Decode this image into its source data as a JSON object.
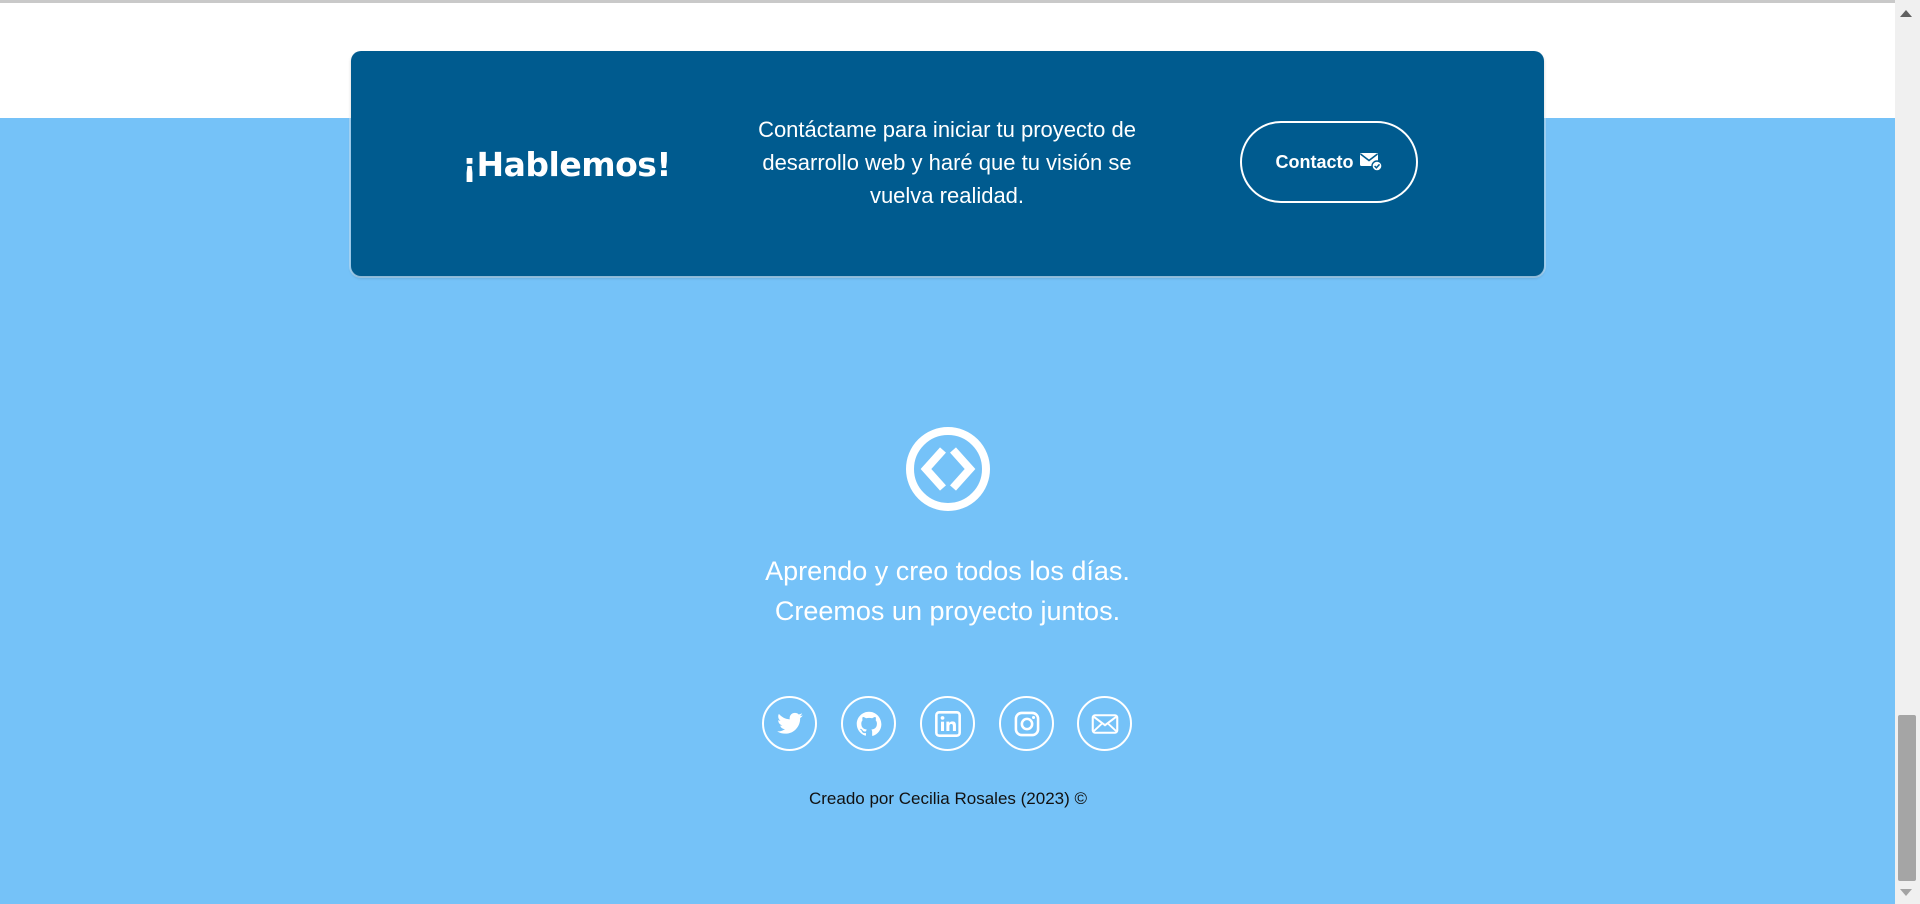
{
  "cta": {
    "title": "¡Hablemos!",
    "text": "Contáctame para iniciar tu proyecto de desarrollo web y haré que tu visión se vuelva realidad.",
    "button_label": "Contacto",
    "button_icon": "mail-check-icon"
  },
  "footer": {
    "logo_icon": "code-circle-icon",
    "tagline_line1": "Aprendo y creo todos los días.",
    "tagline_line2": "Creemos un proyecto juntos.",
    "social": [
      {
        "name": "twitter",
        "icon": "twitter-icon"
      },
      {
        "name": "github",
        "icon": "github-icon"
      },
      {
        "name": "linkedin",
        "icon": "linkedin-icon"
      },
      {
        "name": "instagram",
        "icon": "instagram-icon"
      },
      {
        "name": "email",
        "icon": "envelope-icon"
      }
    ],
    "credits": "Creado por Cecilia Rosales (2023) ©"
  },
  "colors": {
    "page_bg": "#ffffff",
    "footer_bg": "#75c2f8",
    "card_bg": "#005b8f",
    "text_light": "#ffffff",
    "text_dark": "#111111"
  }
}
